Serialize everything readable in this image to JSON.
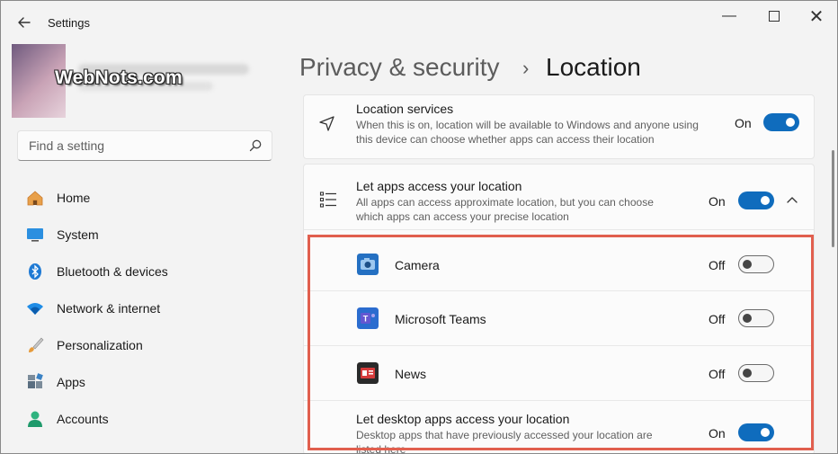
{
  "window": {
    "title": "Settings"
  },
  "watermark": "WebNots.com",
  "search": {
    "placeholder": "Find a setting"
  },
  "nav": [
    {
      "label": "Home",
      "icon": "home-icon"
    },
    {
      "label": "System",
      "icon": "system-icon"
    },
    {
      "label": "Bluetooth & devices",
      "icon": "bluetooth-icon"
    },
    {
      "label": "Network & internet",
      "icon": "wifi-icon"
    },
    {
      "label": "Personalization",
      "icon": "brush-icon"
    },
    {
      "label": "Apps",
      "icon": "apps-icon"
    },
    {
      "label": "Accounts",
      "icon": "accounts-icon"
    }
  ],
  "breadcrumb": {
    "parent": "Privacy & security",
    "separator": "›",
    "current": "Location"
  },
  "location_services": {
    "title": "Location services",
    "desc1": "When this is on, location will be available to Windows and anyone using",
    "desc2": "this device can choose whether apps can access their location",
    "state": "On"
  },
  "apps_access": {
    "title": "Let apps access your location",
    "desc1": "All apps can access approximate location, but you can choose",
    "desc2": "which apps can access your precise location",
    "state": "On"
  },
  "apps": [
    {
      "name": "Camera",
      "state": "Off"
    },
    {
      "name": "Microsoft Teams",
      "state": "Off"
    },
    {
      "name": "News",
      "state": "Off"
    }
  ],
  "desktop_apps": {
    "title": "Let desktop apps access your location",
    "desc1": "Desktop apps that have previously accessed your location are",
    "desc2": "listed here",
    "state": "On"
  },
  "colors": {
    "accent": "#0f6cbd",
    "highlight": "#e15f4e"
  }
}
